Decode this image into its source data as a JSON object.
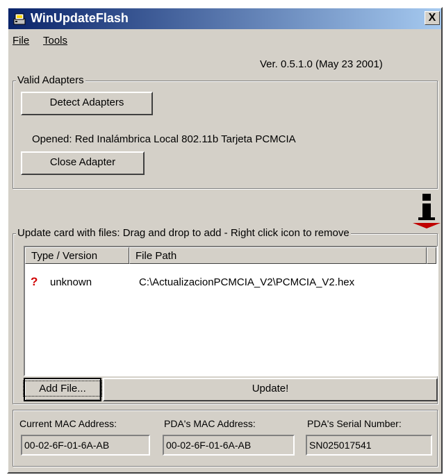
{
  "window": {
    "title": "WinUpdateFlash",
    "close_label": "X"
  },
  "menu": {
    "file": "File",
    "tools": "Tools"
  },
  "version": "Ver. 0.5.1.0  (May 23 2001)",
  "adapters": {
    "group_label": "Valid Adapters",
    "detect_button": "Detect Adapters",
    "opened_text": "Opened: Red Inalámbrica Local 802.11b Tarjeta PCMCIA",
    "close_button": "Close Adapter"
  },
  "update": {
    "group_label": "Update card with files:   Drag and drop to add - Right click icon to remove",
    "columns": [
      "Type / Version",
      "File Path"
    ],
    "rows": [
      {
        "status_icon": "question-mark-icon",
        "status_glyph": "?",
        "type": "unknown",
        "path": "C:\\ActualizacionPCMCIA_V2\\PCMCIA_V2.hex"
      }
    ],
    "add_file_button": "Add File...",
    "update_button": "Update!"
  },
  "info": {
    "current_mac_label": "Current MAC Address:",
    "current_mac": "00-02-6F-01-6A-AB",
    "pda_mac_label": "PDA's MAC Address:",
    "pda_mac": "00-02-6F-01-6A-AB",
    "pda_serial_label": "PDA's Serial Number:",
    "pda_serial": "SN025017541"
  },
  "colors": {
    "titlebar_start": "#0a246a",
    "titlebar_end": "#a6caf0",
    "face": "#d4d0c8",
    "accent_red": "#c00000"
  }
}
